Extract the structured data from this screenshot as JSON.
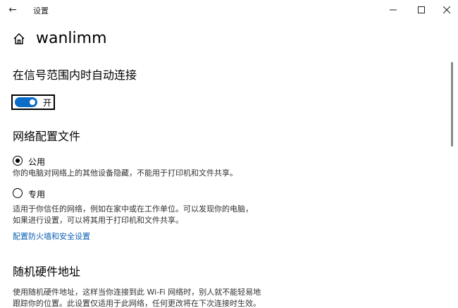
{
  "window": {
    "title": "设置",
    "controls": {
      "minimize": "—",
      "maximize": "☐",
      "close": "✕"
    }
  },
  "page": {
    "title": "wanlimm"
  },
  "auto_connect": {
    "heading": "在信号范围内时自动连接",
    "toggle_state_label": "开",
    "toggle_on": true
  },
  "profile": {
    "heading": "网络配置文件",
    "options": [
      {
        "label": "公用",
        "selected": true,
        "description": "你的电脑对网络上的其他设备隐藏，不能用于打印机和文件共享。"
      },
      {
        "label": "专用",
        "selected": false,
        "description": "适用于你信任的网络，例如在家中或在工作单位。可以发现你的电脑，如果进行设置，可以将其用于打印机和文件共享。"
      }
    ],
    "firewall_link": "配置防火墙和安全设置"
  },
  "random_hw": {
    "heading": "随机硬件地址",
    "description": "使用随机硬件地址，这样当你连接到此 Wi-Fi 网络时，别人就不能轻易地跟踪你的位置。此设置仅适用于此网络，任何更改将在下次连接时生效。"
  },
  "colors": {
    "accent": "#0a6cc6",
    "link": "#0a5fb4"
  }
}
